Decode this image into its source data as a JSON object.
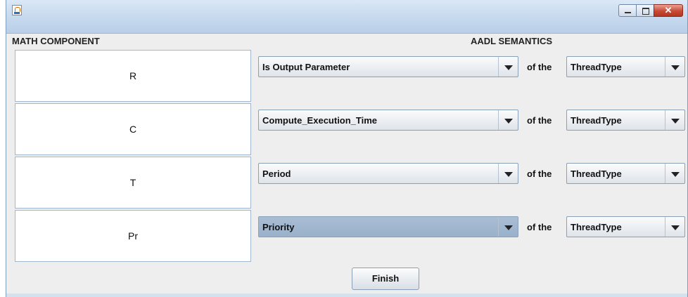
{
  "window": {
    "icon": "java-cup-icon"
  },
  "headers": {
    "math": "MATH COMPONENT",
    "aadl": "AADL SEMANTICS"
  },
  "rows": [
    {
      "math": "R",
      "semantic": "Is Output Parameter",
      "of": "of the",
      "type": "ThreadType"
    },
    {
      "math": "C",
      "semantic": "Compute_Execution_Time",
      "of": "of the",
      "type": "ThreadType"
    },
    {
      "math": "T",
      "semantic": "Period",
      "of": "of the",
      "type": "ThreadType"
    },
    {
      "math": "Pr",
      "semantic": "Priority",
      "of": "of the",
      "type": "ThreadType"
    }
  ],
  "finish_label": "Finish",
  "colors": {
    "titlebar": "#c9dbef",
    "selected_combo": "#9ab1cb",
    "close_button": "#c84a35"
  }
}
